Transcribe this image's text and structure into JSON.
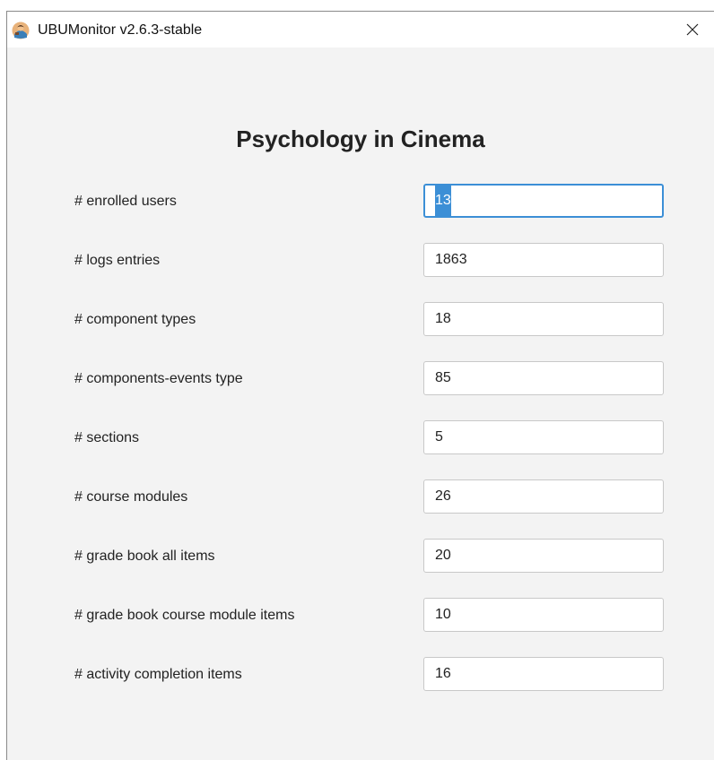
{
  "window": {
    "title": "UBUMonitor v2.6.3-stable",
    "app_icon": "app-avatar-icon",
    "close_icon": "close-icon"
  },
  "course": {
    "title": "Psychology in Cinema"
  },
  "stats": [
    {
      "label": "# enrolled users",
      "value": "13",
      "focused": true
    },
    {
      "label": "# logs entries",
      "value": "1863"
    },
    {
      "label": "# component types",
      "value": "18"
    },
    {
      "label": "# components-events type",
      "value": "85"
    },
    {
      "label": "# sections",
      "value": "5"
    },
    {
      "label": "# course modules",
      "value": "26"
    },
    {
      "label": "# grade book all items",
      "value": "20"
    },
    {
      "label": "# grade book course module items",
      "value": "10"
    },
    {
      "label": "# activity completion items",
      "value": "16"
    }
  ],
  "colors": {
    "focus_border": "#3c8fd6",
    "background": "#f3f3f3"
  }
}
